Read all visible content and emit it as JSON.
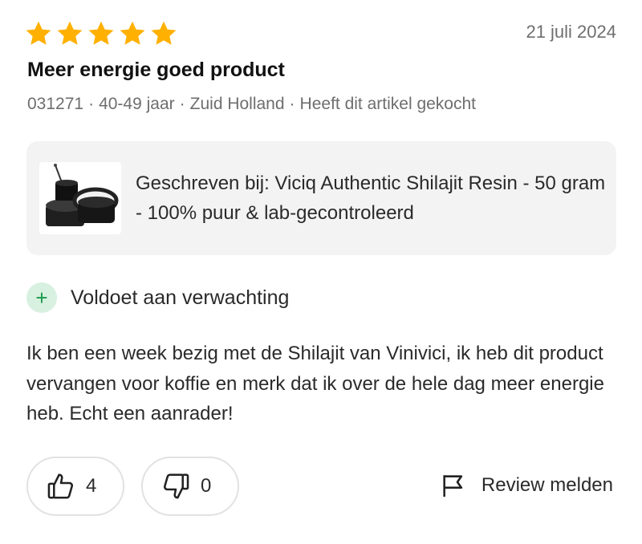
{
  "review": {
    "rating": 5,
    "rating_max": 5,
    "star_color": "#ffb000",
    "date": "21 juli 2024",
    "title": "Meer energie goed product",
    "meta": {
      "reviewer": "031271",
      "age_group": "40-49 jaar",
      "region": "Zuid Holland",
      "purchase_status": "Heeft dit artikel gekocht",
      "separator": "·"
    },
    "product": {
      "text": "Geschreven bij: Viciq Authentic Shilajit Resin - 50 gram - 100% puur & lab-gecontroleerd"
    },
    "verdict": {
      "icon": "plus-icon",
      "symbol": "+",
      "label": "Voldoet aan verwachting"
    },
    "body": "Ik ben een week bezig met de Shilajit van Vinivici, ik heb dit product vervangen voor koffie en merk dat ik over de hele dag meer energie heb. Echt een aanrader!",
    "actions": {
      "thumbs_up_count": "4",
      "thumbs_down_count": "0",
      "report_label": "Review melden"
    }
  }
}
